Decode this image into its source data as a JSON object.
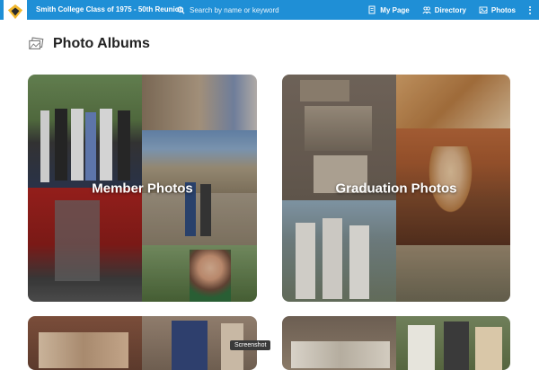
{
  "header": {
    "site_title": "Smith College Class of 1975 - 50th Reunion",
    "search_placeholder": "Search by name or keyword",
    "nav": [
      {
        "label": "My Page",
        "icon": "document-icon"
      },
      {
        "label": "Directory",
        "icon": "people-icon"
      },
      {
        "label": "Photos",
        "icon": "photos-icon"
      }
    ],
    "colors": {
      "bar": "#1f8fd6",
      "logo_accent": "#f2b82e"
    }
  },
  "page": {
    "title": "Photo Albums",
    "title_icon": "photo-albums-icon"
  },
  "albums": [
    {
      "label": "Member Photos"
    },
    {
      "label": "Graduation Photos"
    },
    {
      "label": ""
    },
    {
      "label": ""
    }
  ],
  "tooltip": "Screenshot"
}
